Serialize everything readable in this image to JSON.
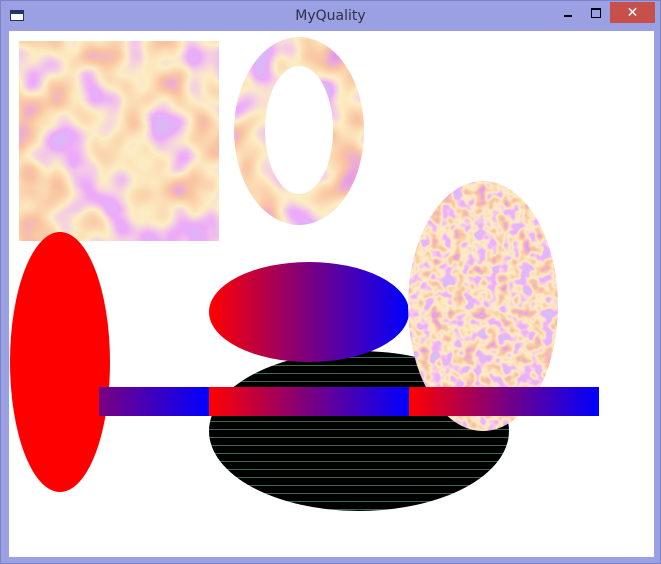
{
  "window": {
    "title": "MyQuality",
    "buttons": {
      "minimize": "",
      "maximize": "",
      "close": "✕"
    }
  },
  "colors": {
    "accent_red": "#ff0000",
    "accent_blue": "#0000ff",
    "accent_purple": "#7a0080",
    "stripe_black": "#000000",
    "titlebar": "#9aa0e2",
    "close_button": "#c7504a"
  },
  "icons": {
    "app": "app-window-icon",
    "minimize": "minimize-icon",
    "maximize": "maximize-icon",
    "close": "close-icon"
  }
}
